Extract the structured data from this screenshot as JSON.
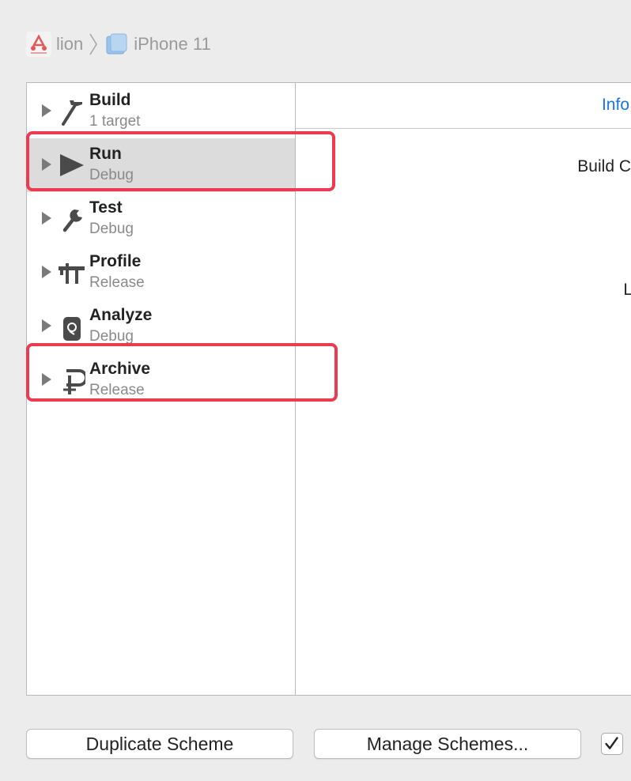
{
  "breadcrumb": {
    "scheme_name": "lion",
    "device_name": "iPhone 11"
  },
  "sidebar": {
    "actions": [
      {
        "title": "Build",
        "subtitle": "1 target",
        "icon": "hammer-icon"
      },
      {
        "title": "Run",
        "subtitle": "Debug",
        "icon": "play-icon"
      },
      {
        "title": "Test",
        "subtitle": "Debug",
        "icon": "wrench-icon"
      },
      {
        "title": "Profile",
        "subtitle": "Release",
        "icon": "caliper-icon"
      },
      {
        "title": "Analyze",
        "subtitle": "Debug",
        "icon": "analyze-icon"
      },
      {
        "title": "Archive",
        "subtitle": "Release",
        "icon": "clamp-icon"
      }
    ],
    "selected_index": 1
  },
  "content": {
    "tab_info": "Info",
    "build_config_label": "Build C",
    "launch_label": "L"
  },
  "footer": {
    "duplicate_label": "Duplicate Scheme",
    "manage_label": "Manage Schemes..."
  },
  "colors": {
    "highlight": "#ec3a4e",
    "link": "#1a73e8",
    "selected_row": "#dcdcdc"
  }
}
